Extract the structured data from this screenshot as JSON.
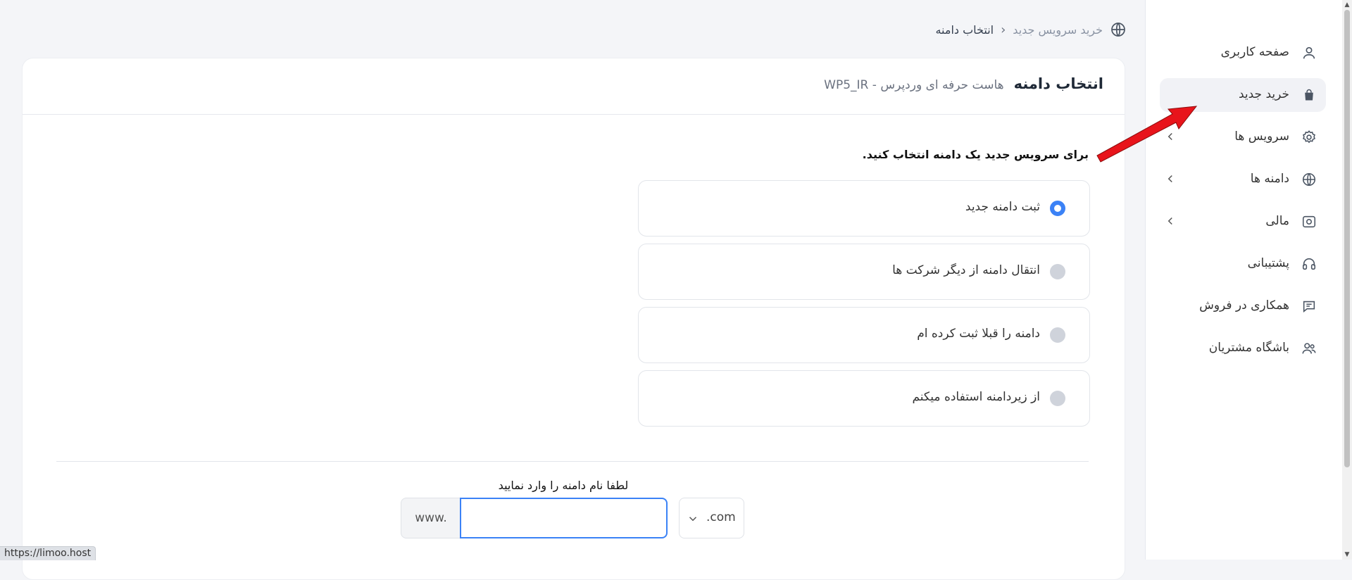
{
  "breadcrumb": {
    "parent": "خرید سرویس جدید",
    "current": "انتخاب دامنه",
    "icon": "globe-icon"
  },
  "sidebar": {
    "items": [
      {
        "label": "صفحه کاربری",
        "icon": "user-icon",
        "active": false,
        "has_chevron": false
      },
      {
        "label": "خرید جدید",
        "icon": "shopping-bag-icon",
        "active": true,
        "has_chevron": false
      },
      {
        "label": "سرویس ها",
        "icon": "gear-icon",
        "active": false,
        "has_chevron": true
      },
      {
        "label": "دامنه ها",
        "icon": "globe-icon",
        "active": false,
        "has_chevron": true
      },
      {
        "label": "مالی",
        "icon": "cash-icon",
        "active": false,
        "has_chevron": true
      },
      {
        "label": "پشتیبانی",
        "icon": "headset-icon",
        "active": false,
        "has_chevron": false
      },
      {
        "label": "همکاری در فروش",
        "icon": "chat-icon",
        "active": false,
        "has_chevron": false
      },
      {
        "label": "باشگاه مشتریان",
        "icon": "users-icon",
        "active": false,
        "has_chevron": false
      }
    ]
  },
  "card": {
    "title": "انتخاب دامنه",
    "subtitle": "هاست حرفه ای وردپرس - WP5_IR"
  },
  "instruction": "برای سرویس جدید یک دامنه انتخاب کنید.",
  "options": [
    {
      "label": "ثبت دامنه جدید",
      "checked": true
    },
    {
      "label": "انتقال دامنه از دیگر شرکت ها",
      "checked": false
    },
    {
      "label": "دامنه را قبلا ثبت کرده ام",
      "checked": false
    },
    {
      "label": "از زیردامنه استفاده میکنم",
      "checked": false
    }
  ],
  "domain_form": {
    "label": "لطفا نام دامنه را وارد نمایید",
    "prefix": "www.",
    "input_value": "",
    "tld_selected": ".com"
  },
  "status_url": "https://limoo.host",
  "colors": {
    "accent": "#3b82f6",
    "arrow": "#e8141b",
    "active_nav_bg": "#f1f2f6"
  }
}
